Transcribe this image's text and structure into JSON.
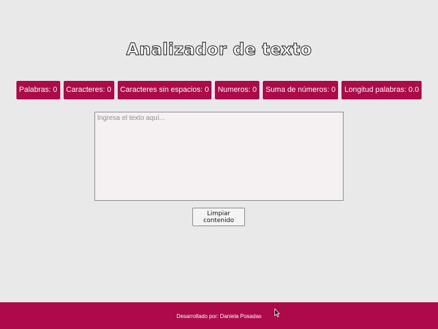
{
  "title": "Analizador de texto",
  "stats": [
    {
      "label": "Palabras",
      "value": "0"
    },
    {
      "label": "Caracteres",
      "value": "0"
    },
    {
      "label": "Caracteres sin espacios",
      "value": "0"
    },
    {
      "label": "Numeros",
      "value": "0"
    },
    {
      "label": "Suma de números",
      "value": "0"
    },
    {
      "label": "Longitud palabras",
      "value": "0.0"
    }
  ],
  "textarea": {
    "value": "",
    "placeholder": "Ingresa el texto aquí..."
  },
  "clear_button": {
    "label": "Limpiar contenido"
  },
  "footer": {
    "text": "Desarrollado por: Daniela Posadas"
  },
  "colors": {
    "accent": "#ad0a4a",
    "background": "#e9e9e9",
    "textarea_bg": "#f5f0f2"
  },
  "icons": {
    "cursor": "mouse-pointer-icon"
  }
}
